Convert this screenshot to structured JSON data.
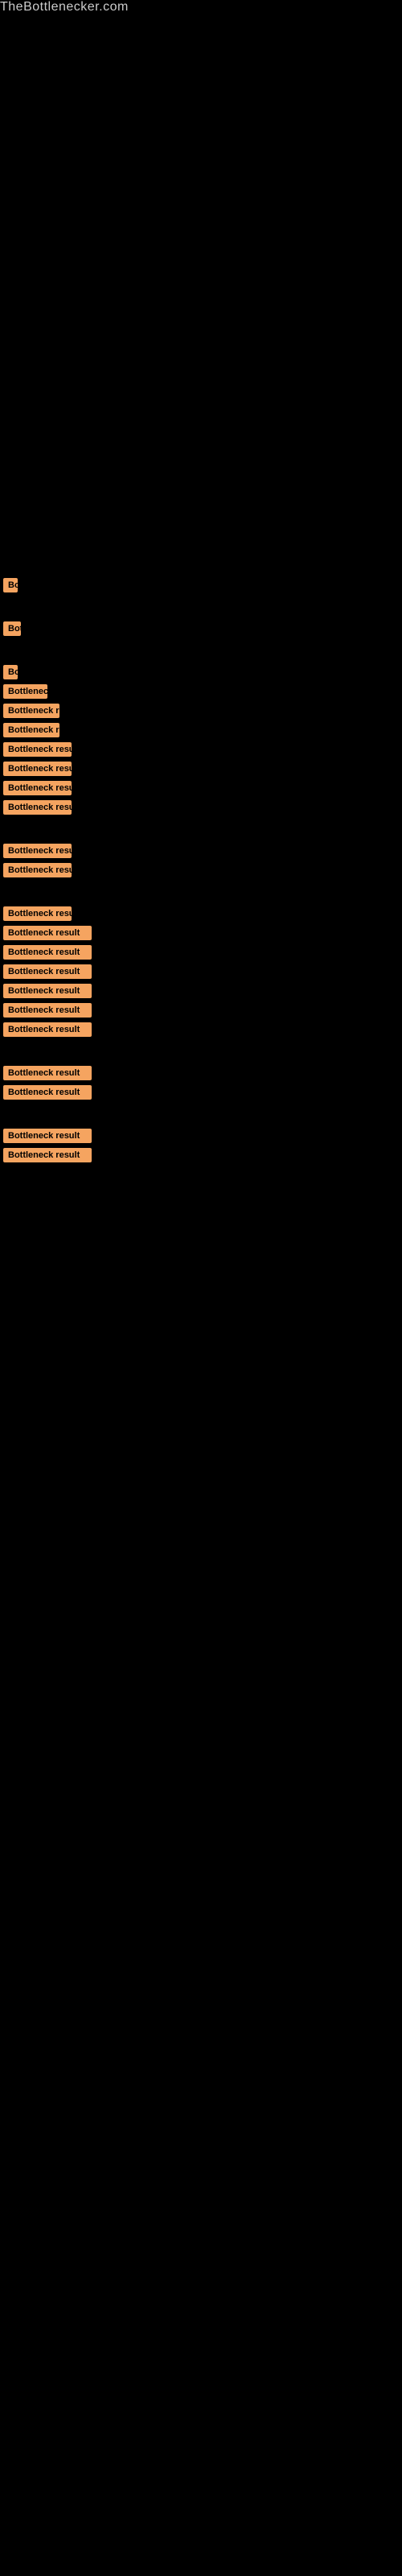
{
  "site": {
    "title": "TheBottlenecker.com"
  },
  "results": [
    {
      "label": "Bottleneck result",
      "size": "xs",
      "id": 1
    },
    {
      "label": "Bottleneck result",
      "size": "sm",
      "id": 2
    },
    {
      "label": "Bottleneck result",
      "size": "xs",
      "id": 3
    },
    {
      "label": "Bottleneck result",
      "size": "lg",
      "id": 4
    },
    {
      "label": "Bottleneck result",
      "size": "xl",
      "id": 5
    },
    {
      "label": "Bottleneck result",
      "size": "xl",
      "id": 6
    },
    {
      "label": "Bottleneck result",
      "size": "xxl",
      "id": 7
    },
    {
      "label": "Bottleneck result",
      "size": "xxl",
      "id": 8
    },
    {
      "label": "Bottleneck result",
      "size": "xxl",
      "id": 9
    },
    {
      "label": "Bottleneck result",
      "size": "xxl",
      "id": 10
    },
    {
      "label": "Bottleneck result",
      "size": "xxl",
      "id": 11
    },
    {
      "label": "Bottleneck result",
      "size": "full",
      "id": 12
    },
    {
      "label": "Bottleneck result",
      "size": "full",
      "id": 13
    },
    {
      "label": "Bottleneck result",
      "size": "full",
      "id": 14
    },
    {
      "label": "Bottleneck result",
      "size": "full",
      "id": 15
    },
    {
      "label": "Bottleneck result",
      "size": "full",
      "id": 16
    },
    {
      "label": "Bottleneck result",
      "size": "full",
      "id": 17
    },
    {
      "label": "Bottleneck result",
      "size": "full",
      "id": 18
    },
    {
      "label": "Bottleneck result",
      "size": "full",
      "id": 19
    },
    {
      "label": "Bottleneck result",
      "size": "full",
      "id": 20
    },
    {
      "label": "Bottleneck result",
      "size": "full",
      "id": 21
    },
    {
      "label": "Bottleneck result",
      "size": "full",
      "id": 22
    },
    {
      "label": "Bottleneck result",
      "size": "full",
      "id": 23
    }
  ]
}
